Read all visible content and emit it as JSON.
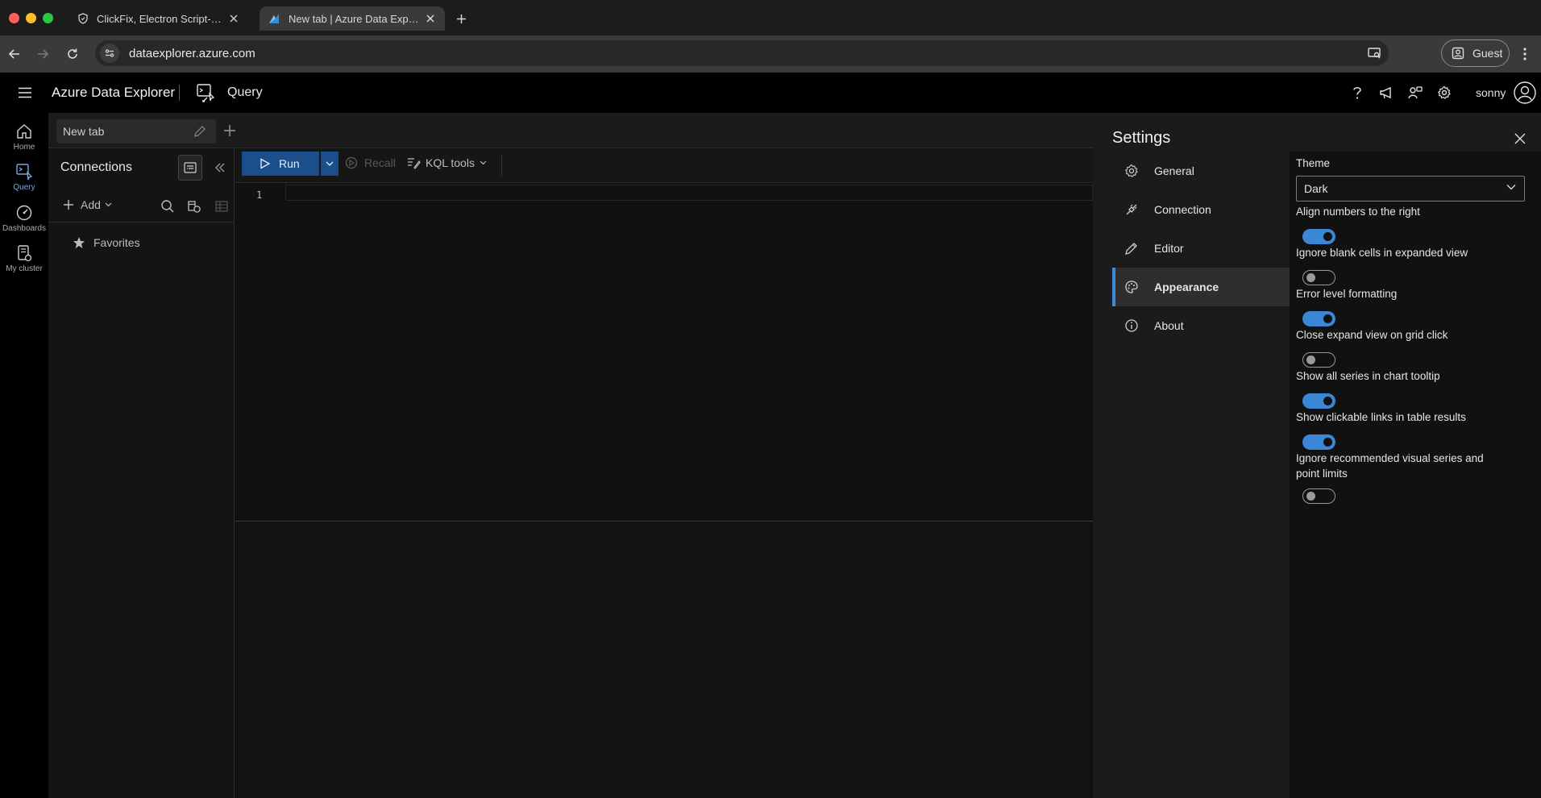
{
  "browser": {
    "tabs": [
      {
        "title": "ClickFix, Electron Script-jacking",
        "active": false,
        "favicon": "shield-icon"
      },
      {
        "title": "New tab | Azure Data Explorer",
        "active": true,
        "favicon": "azure-data-explorer-icon"
      }
    ],
    "url": "dataexplorer.azure.com",
    "profile_label": "Guest"
  },
  "app": {
    "title": "Azure Data Explorer",
    "section": "Query",
    "user": "sonny",
    "accent_color": "#3b86d6"
  },
  "rail": {
    "items": [
      {
        "label": "Home",
        "icon": "home-icon"
      },
      {
        "label": "Query",
        "icon": "query-icon",
        "active": true
      },
      {
        "label": "Dashboards",
        "icon": "dashboard-icon"
      },
      {
        "label": "My cluster",
        "icon": "cluster-icon"
      }
    ]
  },
  "query_tab": {
    "label": "New tab"
  },
  "connections": {
    "title": "Connections",
    "add_label": "Add",
    "favorites_label": "Favorites"
  },
  "editor": {
    "run_label": "Run",
    "recall_label": "Recall",
    "kql_tools_label": "KQL tools",
    "line_number": "1"
  },
  "settings": {
    "title": "Settings",
    "nav": [
      {
        "label": "General",
        "icon": "gear-icon"
      },
      {
        "label": "Connection",
        "icon": "plug-icon"
      },
      {
        "label": "Editor",
        "icon": "pencil-icon"
      },
      {
        "label": "Appearance",
        "icon": "palette-icon",
        "active": true
      },
      {
        "label": "About",
        "icon": "info-icon"
      }
    ],
    "theme_label": "Theme",
    "theme_value": "Dark",
    "toggles": [
      {
        "label": "Align numbers to the right",
        "on": true
      },
      {
        "label": "Ignore blank cells in expanded view",
        "on": false
      },
      {
        "label": "Error level formatting",
        "on": true
      },
      {
        "label": "Close expand view on grid click",
        "on": false
      },
      {
        "label": "Show all series in chart tooltip",
        "on": true
      },
      {
        "label": "Show clickable links in table results",
        "on": true
      },
      {
        "label": "Ignore recommended visual series and point limits",
        "on": false
      }
    ]
  }
}
